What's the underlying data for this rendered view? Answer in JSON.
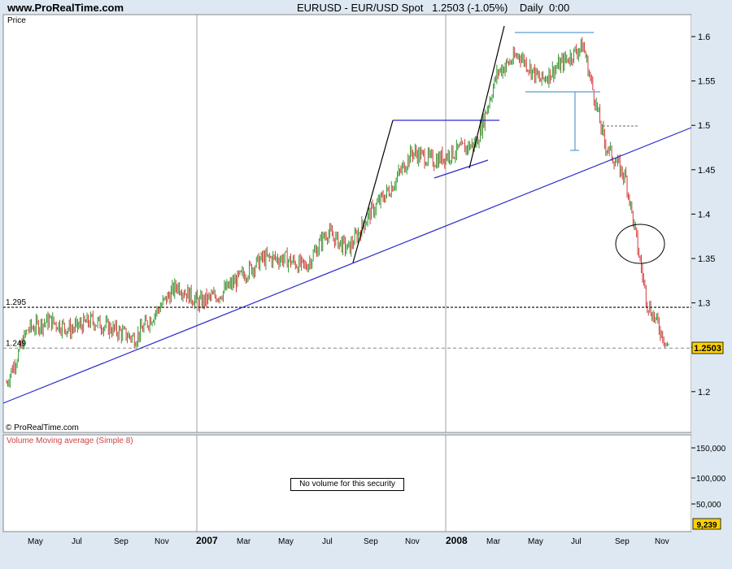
{
  "header": {
    "url": "www.ProRealTime.com",
    "symbol": "EURUSD - EUR/USD Spot",
    "last": "1.2503 (-1.05%)",
    "period": "Daily  0:00"
  },
  "price_panel": {
    "label": "Price",
    "copyright": "© ProRealTime.com",
    "current_price_tag": "1.2503",
    "level_labels": [
      "1.295",
      "1.249"
    ]
  },
  "volume_panel": {
    "title": "Volume Moving average (Simple 8)",
    "message": "No volume for this security",
    "ticks": [
      "150,000",
      "100,000",
      "50,000"
    ],
    "current_tag": "9,239"
  },
  "colors": {
    "background": "#ffffff",
    "frame": "#dde8f2",
    "up_bar": "#2e9a2e",
    "down_bar": "#d23a3a",
    "trendline": "#2a2acd",
    "pattern_line": "#000000",
    "range_line": "#5b9bd5",
    "price_tag": "#ffd200",
    "volume_title": "#cc4444"
  },
  "chart_data": {
    "type": "line",
    "title": "EURUSD - EUR/USD Spot",
    "ylabel": "Price",
    "ylim": [
      1.15,
      1.63
    ],
    "yticks": [
      1.2,
      1.25,
      1.3,
      1.35,
      1.4,
      1.45,
      1.5,
      1.55,
      1.6
    ],
    "x_tick_labels": [
      "May",
      "Jul",
      "Sep",
      "Nov",
      "2007",
      "Mar",
      "May",
      "Jul",
      "Sep",
      "Nov",
      "2008",
      "Mar",
      "May",
      "Jul",
      "Sep",
      "Nov"
    ],
    "x": [
      "2006-04",
      "2006-05",
      "2006-06",
      "2006-07",
      "2006-08",
      "2006-09",
      "2006-10",
      "2006-11",
      "2006-12",
      "2007-01",
      "2007-02",
      "2007-03",
      "2007-04",
      "2007-05",
      "2007-06",
      "2007-07",
      "2007-08",
      "2007-09",
      "2007-10",
      "2007-11",
      "2007-12",
      "2008-01",
      "2008-02",
      "2008-03",
      "2008-04",
      "2008-05",
      "2008-06",
      "2008-07",
      "2008-08",
      "2008-09",
      "2008-10",
      "2008-11"
    ],
    "series": [
      {
        "values": [
          1.21,
          1.27,
          1.28,
          1.27,
          1.28,
          1.27,
          1.26,
          1.29,
          1.32,
          1.3,
          1.31,
          1.33,
          1.35,
          1.35,
          1.34,
          1.38,
          1.36,
          1.4,
          1.43,
          1.47,
          1.46,
          1.47,
          1.48,
          1.56,
          1.58,
          1.55,
          1.57,
          1.59,
          1.48,
          1.44,
          1.3,
          1.25
        ]
      }
    ],
    "annotations": [
      {
        "type": "hline",
        "y": 1.295,
        "label": "1.295"
      },
      {
        "type": "hline",
        "y": 1.249,
        "label": "1.249"
      },
      {
        "type": "last_price",
        "y": 1.2503,
        "label": "1.2503"
      }
    ],
    "grid": false
  }
}
